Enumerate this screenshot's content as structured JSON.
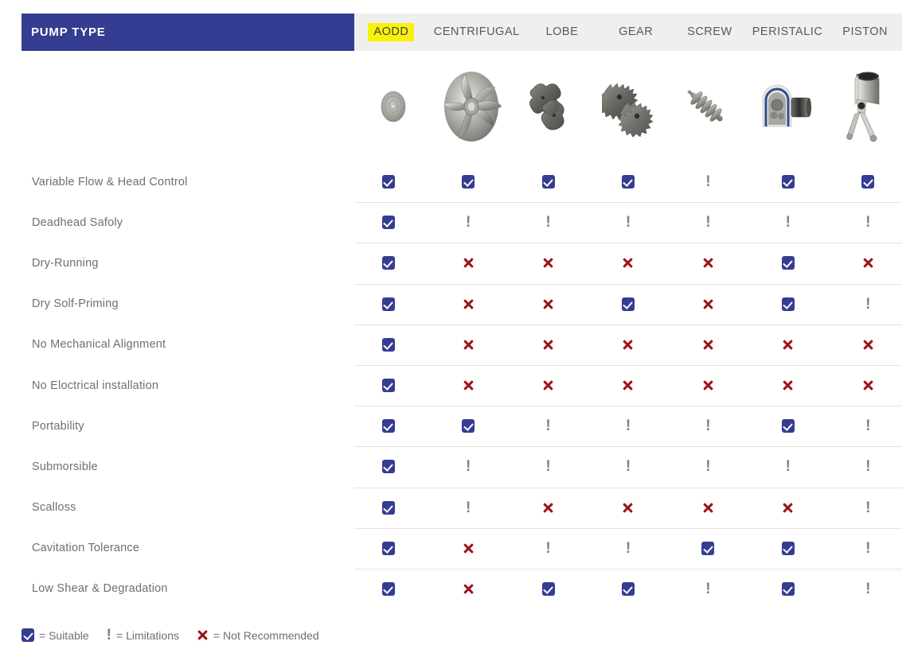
{
  "header": {
    "title": "PUMP TYPE",
    "columns": [
      {
        "label": "AODD",
        "highlight": true,
        "icon": "aodd-diaphragm-icon"
      },
      {
        "label": "CENTRIFUGAL",
        "highlight": false,
        "icon": "centrifugal-impeller-icon"
      },
      {
        "label": "LOBE",
        "highlight": false,
        "icon": "lobe-rotor-icon"
      },
      {
        "label": "GEAR",
        "highlight": false,
        "icon": "gear-rotor-icon"
      },
      {
        "label": "SCREW",
        "highlight": false,
        "icon": "screw-rotor-icon"
      },
      {
        "label": "PERISTALIC",
        "highlight": false,
        "icon": "peristaltic-head-icon"
      },
      {
        "label": "PISTON",
        "highlight": false,
        "icon": "piston-rod-icon"
      }
    ]
  },
  "rows": [
    {
      "label": "Variable Flow & Head Control",
      "values": [
        "check",
        "check",
        "check",
        "check",
        "excl",
        "check",
        "check"
      ]
    },
    {
      "label": "Deadhead Safoly",
      "values": [
        "check",
        "excl",
        "excl",
        "excl",
        "excl",
        "excl",
        "excl"
      ]
    },
    {
      "label": "Dry-Running",
      "values": [
        "check",
        "x",
        "x",
        "x",
        "x",
        "check",
        "x"
      ]
    },
    {
      "label": "Dry Solf-Priming",
      "values": [
        "check",
        "x",
        "x",
        "check",
        "x",
        "check",
        "excl"
      ]
    },
    {
      "label": "No Mechanical Alignment",
      "values": [
        "check",
        "x",
        "x",
        "x",
        "x",
        "x",
        "x"
      ]
    },
    {
      "label": "No Eloctrical installation",
      "values": [
        "check",
        "x",
        "x",
        "x",
        "x",
        "x",
        "x"
      ]
    },
    {
      "label": "Portability",
      "values": [
        "check",
        "check",
        "excl",
        "excl",
        "excl",
        "check",
        "excl"
      ]
    },
    {
      "label": "Submorsible",
      "values": [
        "check",
        "excl",
        "excl",
        "excl",
        "excl",
        "excl",
        "excl"
      ]
    },
    {
      "label": "Scalloss",
      "values": [
        "check",
        "excl",
        "x",
        "x",
        "x",
        "x",
        "excl"
      ]
    },
    {
      "label": "Cavitation Tolerance",
      "values": [
        "check",
        "x",
        "excl",
        "excl",
        "check",
        "check",
        "excl"
      ]
    },
    {
      "label": "Low Shear & Degradation",
      "values": [
        "check",
        "x",
        "check",
        "check",
        "excl",
        "check",
        "excl"
      ]
    }
  ],
  "legend": [
    {
      "mark": "check",
      "text": "= Suitable"
    },
    {
      "mark": "excl",
      "text": "= Limitations"
    },
    {
      "mark": "x",
      "text": "= Not Recommended"
    }
  ],
  "colors": {
    "header_blue": "#343d91",
    "highlight_yellow": "#f9f10a",
    "header_gray": "#efefef",
    "check_blue": "#343d91",
    "x_red": "#9e1119",
    "excl_gray": "#8a7f74",
    "label_gray": "#6b7075",
    "divider": "#e3e3e3"
  }
}
